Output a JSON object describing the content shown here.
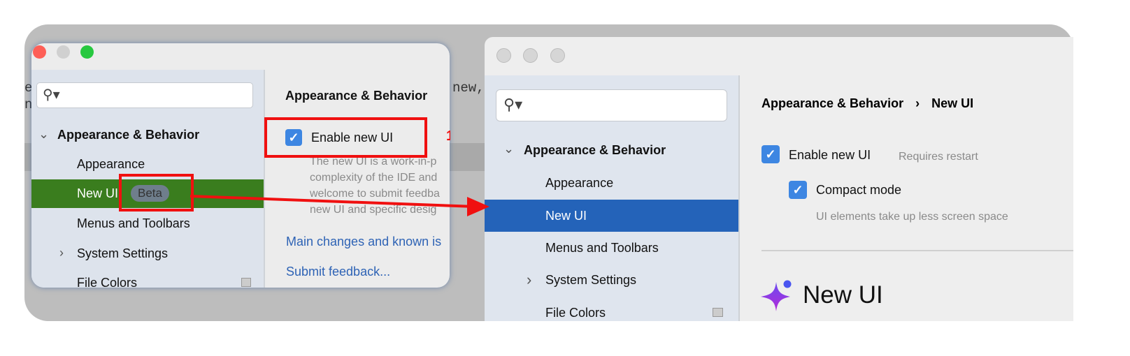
{
  "background_code": {
    "left_fragments": [
      "e",
      "ne"
    ],
    "right_fragment": "new,"
  },
  "old_window": {
    "sidebar": {
      "search_placeholder": "",
      "items": [
        {
          "label": "Appearance & Behavior",
          "expanded": true
        },
        {
          "label": "Appearance"
        },
        {
          "label": "New UI",
          "badge": "Beta",
          "selected": true
        },
        {
          "label": "Menus and Toolbars"
        },
        {
          "label": "System Settings",
          "expandable": true
        },
        {
          "label": "File Colors"
        }
      ]
    },
    "content": {
      "heading": "Appearance & Behavior",
      "enable_checkbox": {
        "label": "Enable new UI",
        "checked": true
      },
      "description_lines": [
        "The new UI is a work-in-p",
        "complexity of the IDE and",
        "welcome to submit feedba",
        "new UI and specific desig"
      ],
      "links": [
        "Main changes and known is",
        "Submit feedback..."
      ]
    },
    "annotation_number": "1",
    "selection_color": "#3a7d1e"
  },
  "new_window": {
    "sidebar": {
      "search_placeholder": "",
      "items": [
        {
          "label": "Appearance & Behavior",
          "expanded": true
        },
        {
          "label": "Appearance"
        },
        {
          "label": "New UI",
          "selected": true
        },
        {
          "label": "Menus and Toolbars"
        },
        {
          "label": "System Settings",
          "expandable": true
        },
        {
          "label": "File Colors"
        }
      ]
    },
    "content": {
      "breadcrumb": [
        "Appearance & Behavior",
        "New UI"
      ],
      "breadcrumb_separator": "›",
      "enable_checkbox": {
        "label": "Enable new UI",
        "checked": true,
        "hint": "Requires restart"
      },
      "compact_checkbox": {
        "label": "Compact mode",
        "checked": true,
        "hint": "UI elements take up less screen space"
      },
      "section_title": "New UI"
    },
    "selection_color": "#2463b9"
  },
  "annotation_color": "#f01010",
  "checkbox_color": "#3d86e2"
}
